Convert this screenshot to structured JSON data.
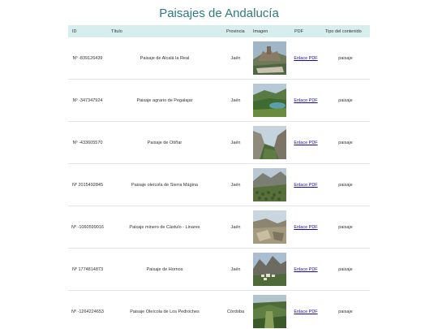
{
  "page": {
    "title": "Paisajes de Andalucía"
  },
  "table": {
    "headers": {
      "id": "ID",
      "titulo": "Título",
      "provincia": "Provincia",
      "imagen": "Imagen",
      "pdf": "PDF",
      "tipo": "Tipo del contenido"
    },
    "rows": [
      {
        "id": "Nº -839126439",
        "titulo": "Paisaje de Alcalá la Real",
        "provincia": "Jaén",
        "pdf": "Enlace PDF",
        "tipo": "paisaje",
        "image_scene": "town-on-hill"
      },
      {
        "id": "Nº -347347924",
        "titulo": "Paisaje agrario de Pegalajar",
        "provincia": "Jaén",
        "pdf": "Enlace PDF",
        "tipo": "paisaje",
        "image_scene": "green-valley-reservoir"
      },
      {
        "id": "Nº -433605570",
        "titulo": "Paisaje de Otíñar",
        "provincia": "Jaén",
        "pdf": "Enlace PDF",
        "tipo": "paisaje",
        "image_scene": "rocky-gorge"
      },
      {
        "id": "Nº 2015492845",
        "titulo": "Paisaje oleícola de Sierra Mágina",
        "provincia": "Jaén",
        "pdf": "Enlace PDF",
        "tipo": "paisaje",
        "image_scene": "olive-groves-mountain"
      },
      {
        "id": "Nº -1060599016",
        "titulo": "Paisaje minero de Cástulo - Linares",
        "provincia": "Jaén",
        "pdf": "Enlace PDF",
        "tipo": "paisaje",
        "image_scene": "rocky-hillside"
      },
      {
        "id": "Nº 1774814873",
        "titulo": "Paisaje de Hornos",
        "provincia": "Jaén",
        "pdf": "Enlace PDF",
        "tipo": "paisaje",
        "image_scene": "mountain-village"
      },
      {
        "id": "Nº -1264224653",
        "titulo": "Paisaje Oleícola de Los Pedroches",
        "provincia": "Córdoba",
        "pdf": "Enlace PDF",
        "tipo": "paisaje",
        "image_scene": "forest-valley"
      }
    ]
  },
  "colors": {
    "title": "#2e7b83",
    "header_bg": "#d6eeee",
    "link": "#1a0dab"
  }
}
